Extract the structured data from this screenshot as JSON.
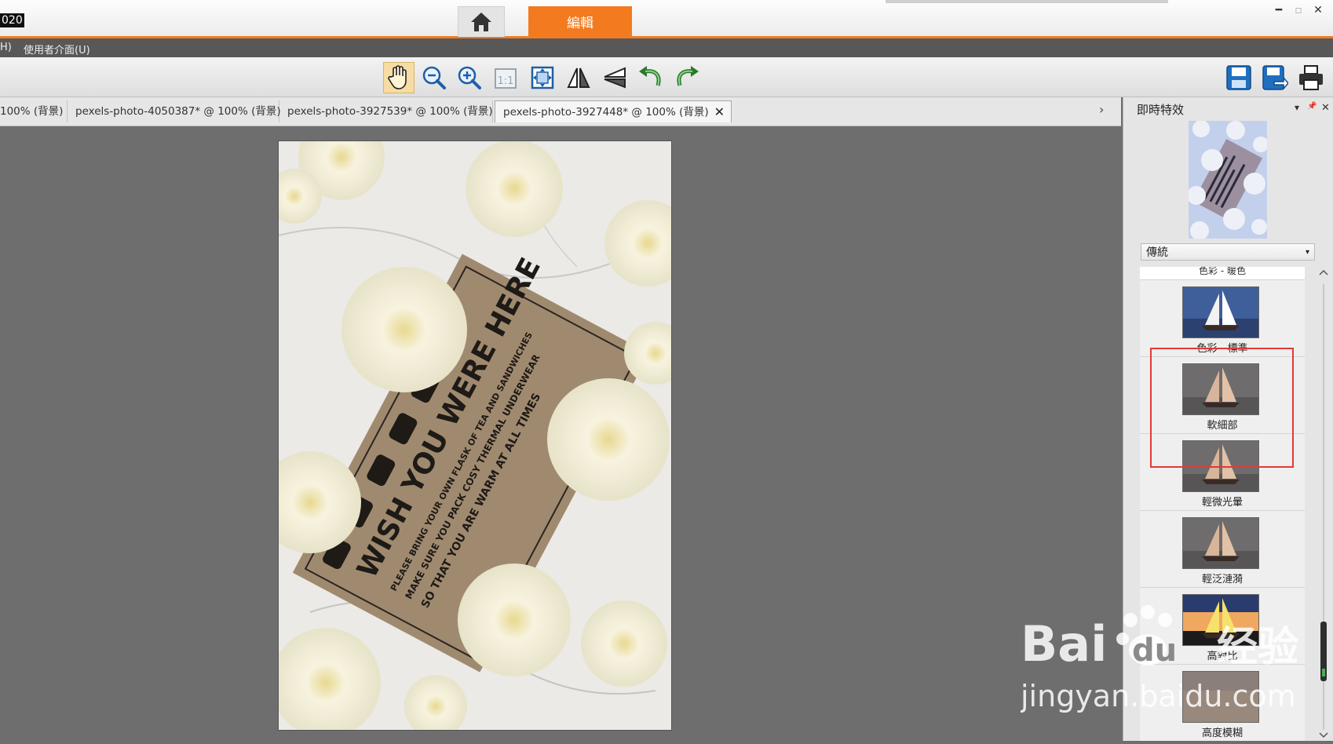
{
  "window": {
    "app_year_fragment": "020",
    "tab_edit": "編輯",
    "minimize": "━",
    "restore": "▫",
    "close": "✕"
  },
  "menu": {
    "item_help_fragment": "H)",
    "item_ui": "使用者介面(U)"
  },
  "toolbar": {
    "tools": [
      "hand-tool",
      "zoom-out",
      "zoom-in",
      "actual-size-1:1",
      "fit-to-window",
      "flip-horizontal",
      "flip-vertical",
      "rotate-left",
      "rotate-right"
    ],
    "actual_size_label": "1:1",
    "right_actions": [
      "save",
      "save-as",
      "print"
    ]
  },
  "doc_tabs": [
    {
      "label": "100% (背景)",
      "active": false
    },
    {
      "label": "pexels-photo-4050387* @ 100% (背景)",
      "active": false
    },
    {
      "label": "pexels-photo-3927539* @ 100% (背景)",
      "active": false
    },
    {
      "label": "pexels-photo-3927448* @ 100% (背景)",
      "active": true
    }
  ],
  "doc_tab_close": "✕",
  "doc_tabs_scroll": "›",
  "canvas": {
    "card_lines": [
      "WISH YOU WERE HERE",
      "PLEASE BRING YOUR OWN FLASK OF TEA AND SANDWICHES",
      "MAKE SURE YOU PACK COSY THERMAL UNDERWEAR",
      "SO THAT YOU ARE WARM AT ALL TIMES"
    ]
  },
  "panel": {
    "title": "即時特效",
    "dropdown_glyph": "▾",
    "pin_glyph": "📌",
    "close_glyph": "✕",
    "style_select_value": "傳統",
    "cut_label": "色彩 - 暖色",
    "effects": [
      {
        "label": "色彩 - 標準",
        "variant": "blue"
      },
      {
        "label": "軟細部",
        "variant": "soft"
      },
      {
        "label": "輕微光暈",
        "variant": "soft"
      },
      {
        "label": "輕泛漣漪",
        "variant": "soft"
      },
      {
        "label": "高對比",
        "variant": "contrast"
      },
      {
        "label": "高度模糊",
        "variant": "blur"
      }
    ]
  },
  "watermark": {
    "brand": "Bai",
    "brand_suffix": "du",
    "brand_cn": "经验",
    "url": "jingyan.baidu.com"
  }
}
